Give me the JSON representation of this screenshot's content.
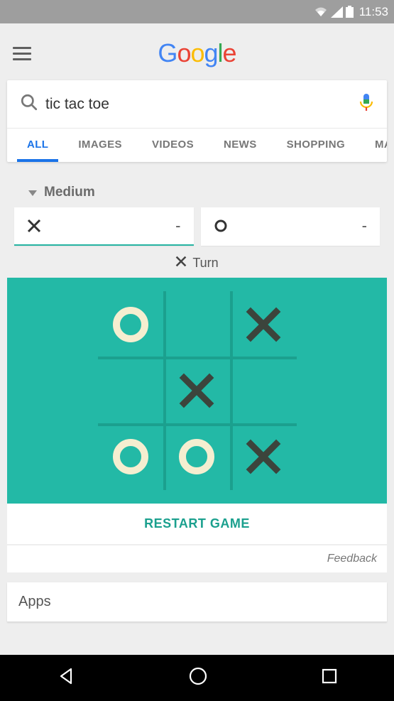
{
  "status": {
    "time": "11:53"
  },
  "logo": {
    "g1": "G",
    "o1": "o",
    "o2": "o",
    "g2": "g",
    "l": "l",
    "e": "e"
  },
  "search": {
    "query": "tic tac toe",
    "placeholder": ""
  },
  "tabs": {
    "all": "ALL",
    "images": "IMAGES",
    "videos": "VIDEOS",
    "news": "NEWS",
    "shopping": "SHOPPING",
    "maps": "MA"
  },
  "game": {
    "difficulty": "Medium",
    "score_x": "-",
    "score_o": "-",
    "turn_label": "Turn",
    "restart": "RESTART GAME"
  },
  "board": {
    "cells": {
      "r0c0": "O",
      "r0c1": "",
      "r0c2": "X",
      "r1c0": "",
      "r1c1": "X",
      "r1c2": "",
      "r2c0": "O",
      "r2c1": "O",
      "r2c2": "X"
    }
  },
  "feedback": "Feedback",
  "apps": {
    "title": "Apps"
  }
}
